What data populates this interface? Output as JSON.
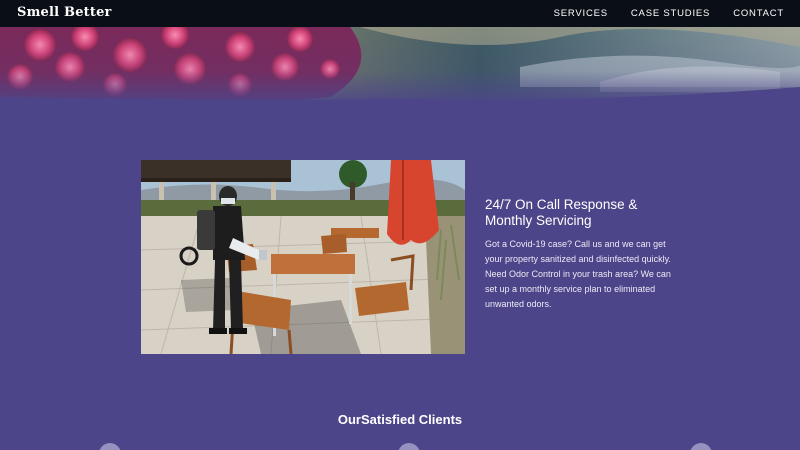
{
  "brand": {
    "name": "Smell Better"
  },
  "nav": {
    "items": [
      {
        "label": "SERVICES"
      },
      {
        "label": "CASE STUDIES"
      },
      {
        "label": "CONTACT"
      }
    ]
  },
  "feature": {
    "heading_line1": "24/7 On Call Response &",
    "heading_line2": "Monthly Servicing",
    "body": "Got a Covid-19 case? Call us and we can get your property sanitized and disinfected quickly. Need Odor Control in your trash area? We can set up a monthly service plan to eliminated unwanted odors."
  },
  "clients": {
    "heading": "OurSatisfied Clients"
  },
  "colors": {
    "page_bg": "#4d4589",
    "nav_bg": "#0a0f17",
    "text": "#ffffff"
  }
}
